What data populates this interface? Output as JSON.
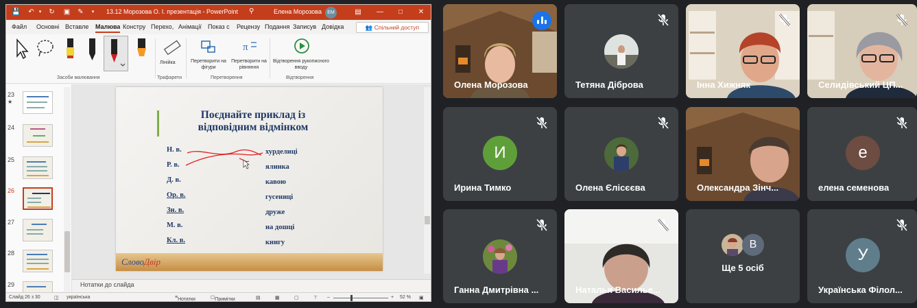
{
  "ppt": {
    "doc_title": "13.12 Морозова О. І. презентація  -  PowerPoint",
    "user_name": "Елена Морозова",
    "user_initials": "ЕМ",
    "tabs": [
      "Файл",
      "Основні",
      "Вставле",
      "Малюва",
      "Констру",
      "Перехо,",
      "Анімації",
      "Показ с",
      "Рецензу",
      "Подання",
      "Записув",
      "Довідка"
    ],
    "active_tab_index": 3,
    "share_label": "Спільний доступ",
    "ribbon": {
      "drawing_group": "Засоби малювання",
      "ruler_label": "Лінійка",
      "stencils_group": "Трафарети",
      "convert_shapes": "Перетворити на фігури",
      "convert_math": "Перетворити на рівняння",
      "convert_group": "Перетворення",
      "replay_label": "Відтворення рукописного вводу",
      "replay_group": "Відтворення"
    },
    "thumbnails": [
      {
        "num": "23",
        "star": true
      },
      {
        "num": "24",
        "star": false
      },
      {
        "num": "25",
        "star": false
      },
      {
        "num": "26",
        "star": false,
        "selected": true
      },
      {
        "num": "27",
        "star": false
      },
      {
        "num": "28",
        "star": false
      },
      {
        "num": "29",
        "star": false
      }
    ],
    "slide": {
      "title": "Поєднайте приклад із відповідним відмінком",
      "cases": [
        "Н. в.",
        "Р. в.",
        "Д. в.",
        "Ор. в.",
        "Зн. в.",
        "М. в.",
        "Кл. в."
      ],
      "words": [
        "хурделиці",
        "ялинка",
        "кавою",
        "гусениці",
        "друже",
        "на дошці",
        "книгу"
      ],
      "logo_a": "Слово",
      "logo_b": "Двір"
    },
    "notes_placeholder": "Нотатки до слайда",
    "status": {
      "slide_pos": "Слайд 26 з 30",
      "language": "українська",
      "notes": "Нотатки",
      "comments": "Примітки",
      "zoom": "52 %"
    },
    "colors": {
      "accent": "#c43e1c",
      "slide_title": "#1f3864"
    }
  },
  "meet": {
    "tiles": [
      {
        "name": "Олена Морозова",
        "type": "video",
        "speaking": true
      },
      {
        "name": "Тетяна Діброва",
        "type": "photo",
        "muted": true
      },
      {
        "name": "Інна Хижняк",
        "type": "video",
        "muted": true
      },
      {
        "name": "Селидівський ЦП...",
        "type": "video",
        "muted": true
      },
      {
        "name": "Ирина Тимко",
        "type": "letter",
        "letter": "И",
        "color": "#5f9f3a",
        "muted": true
      },
      {
        "name": "Олена Єлісєєва",
        "type": "photo",
        "muted": true
      },
      {
        "name": "Олександра Зінч...",
        "type": "video",
        "muted": false
      },
      {
        "name": "елена семенова",
        "type": "letter",
        "letter": "е",
        "color": "#6d4c41",
        "muted": true
      },
      {
        "name": "Ганна Дмитрівна ...",
        "type": "photo",
        "muted": true
      },
      {
        "name": "Наталья Василье...",
        "type": "video",
        "muted": true
      },
      {
        "name": "Ще 5 осіб",
        "type": "more",
        "letter": "В",
        "muted": false
      },
      {
        "name": "Українська Філол...",
        "type": "letter",
        "letter": "У",
        "color": "#607d8b",
        "muted": true
      }
    ]
  }
}
